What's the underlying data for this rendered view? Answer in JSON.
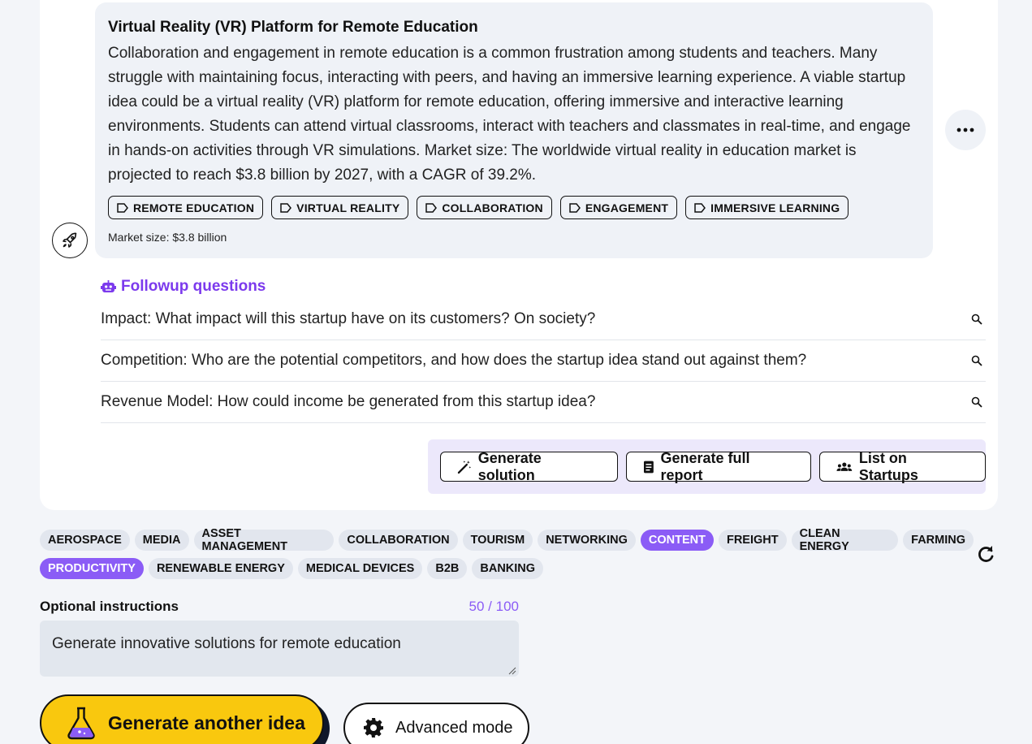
{
  "idea": {
    "title": "Virtual Reality (VR) Platform for Remote Education",
    "description": "Collaboration and engagement in remote education is a common frustration among students and teachers. Many struggle with maintaining focus, interacting with peers, and having an immersive learning experience. A viable startup idea could be a virtual reality (VR) platform for remote education, offering immersive and interactive learning environments. Students can attend virtual classrooms, interact with teachers and classmates in real-time, and engage in hands-on activities through VR simulations. Market size: The worldwide virtual reality in education market is projected to reach $3.8 billion by 2027, with a CAGR of 39.2%.",
    "tags": [
      "REMOTE EDUCATION",
      "VIRTUAL REALITY",
      "COLLABORATION",
      "ENGAGEMENT",
      "IMMERSIVE LEARNING"
    ],
    "market_size": "Market size: $3.8 billion",
    "avatar_icon": "rocket-icon"
  },
  "followup": {
    "heading": "Followup questions",
    "questions": [
      "Impact: What impact will this startup have on its customers? On society?",
      "Competition: Who are the potential competitors, and how does the startup idea stand out against them?",
      "Revenue Model: How could income be generated from this startup idea?"
    ]
  },
  "actions": {
    "generate_solution": "Generate solution",
    "generate_report": "Generate full report",
    "list_startups": "List on Startups"
  },
  "categories": {
    "row1": [
      "AEROSPACE",
      "MEDIA",
      "ASSET MANAGEMENT",
      "COLLABORATION",
      "TOURISM",
      "NETWORKING",
      "CONTENT",
      "FREIGHT",
      "CLEAN ENERGY",
      "FARMING"
    ],
    "row2": [
      "PRODUCTIVITY",
      "RENEWABLE ENERGY",
      "MEDICAL DEVICES",
      "B2B",
      "BANKING"
    ],
    "selected": [
      "CONTENT",
      "PRODUCTIVITY"
    ]
  },
  "instructions": {
    "label": "Optional instructions",
    "count": "50 / 100",
    "value": "Generate innovative solutions for remote education"
  },
  "buttons": {
    "generate_another": "Generate another idea",
    "advanced_mode": "Advanced mode"
  },
  "colors": {
    "accent": "#8b5cf6",
    "primary_button": "#f9c80e",
    "bubble": "#eff2f7"
  }
}
